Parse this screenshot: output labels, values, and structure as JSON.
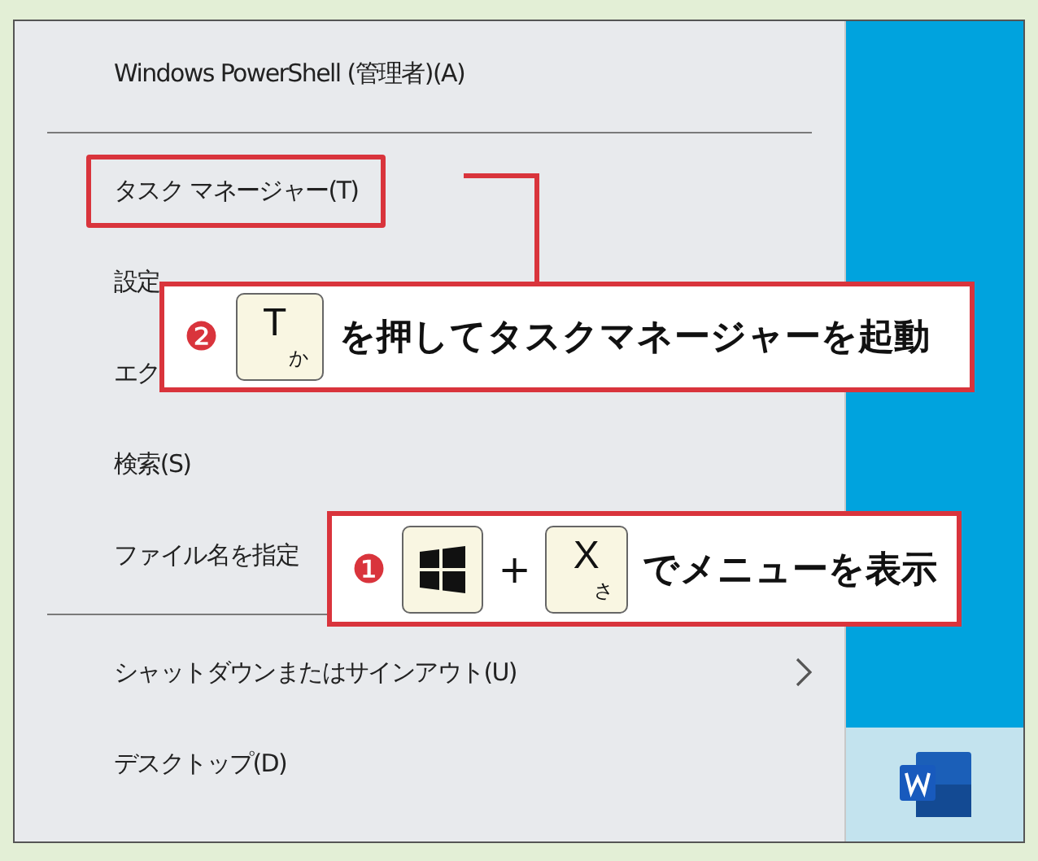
{
  "menu": {
    "items": [
      {
        "kind": "item",
        "label": "Windows PowerShell (管理者)(A)",
        "highlighted": false,
        "submenu": false
      },
      {
        "kind": "separator"
      },
      {
        "kind": "item",
        "label": "タスク マネージャー(T)",
        "highlighted": true,
        "submenu": false
      },
      {
        "kind": "item",
        "label": "設定",
        "highlighted": false,
        "submenu": false
      },
      {
        "kind": "item",
        "label": "エク",
        "highlighted": false,
        "submenu": false
      },
      {
        "kind": "item",
        "label": "検索(S)",
        "highlighted": false,
        "submenu": false
      },
      {
        "kind": "item",
        "label": "ファイル名を指定",
        "highlighted": false,
        "submenu": false
      },
      {
        "kind": "separator"
      },
      {
        "kind": "item",
        "label": "シャットダウンまたはサインアウト(U)",
        "highlighted": false,
        "submenu": true
      },
      {
        "kind": "item",
        "label": "デスクトップ(D)",
        "highlighted": false,
        "submenu": false
      }
    ]
  },
  "callouts": [
    {
      "number": "❷",
      "parts": [
        {
          "kind": "key",
          "main": "T",
          "kana": "か"
        }
      ],
      "text": "を押してタスクマネージャーを起動"
    },
    {
      "number": "❶",
      "parts": [
        {
          "kind": "winkey"
        },
        {
          "kind": "plus",
          "text": "+"
        },
        {
          "kind": "key",
          "main": "X",
          "kana": "さ"
        }
      ],
      "text": "でメニューを表示"
    }
  ]
}
